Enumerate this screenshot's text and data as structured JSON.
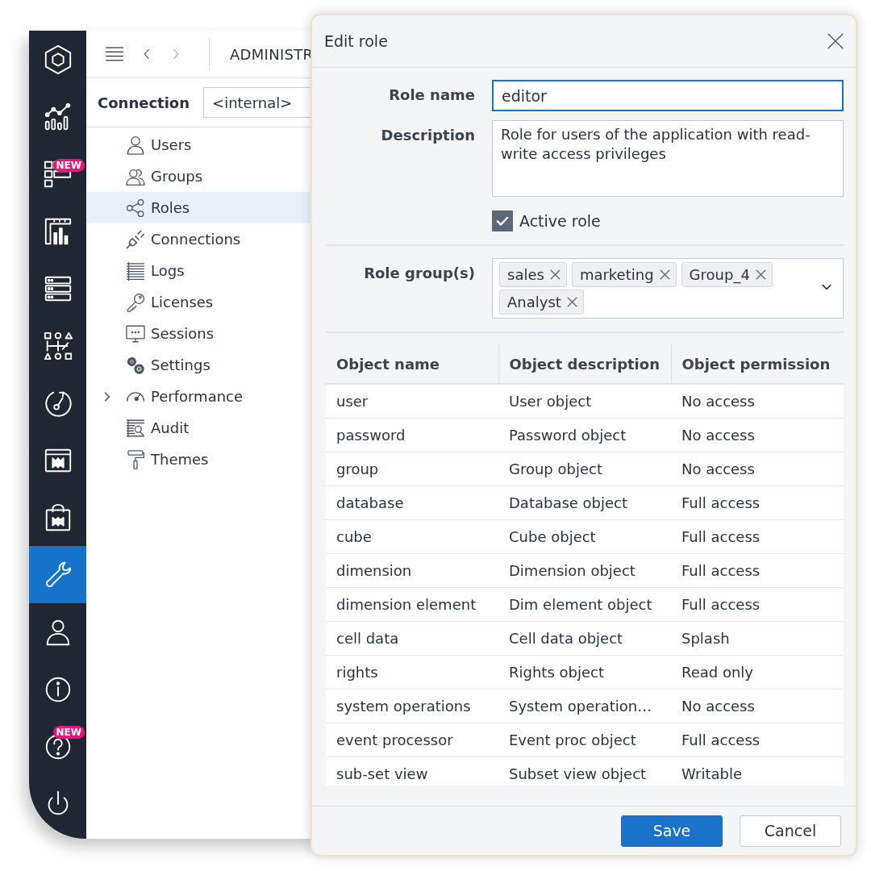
{
  "rail": {
    "items": [
      {
        "selected": false
      },
      {
        "selected": false,
        "badge": "NEW"
      },
      {
        "selected": false
      },
      {
        "selected": false
      },
      {
        "selected": false
      },
      {
        "selected": false
      },
      {
        "selected": false
      },
      {
        "selected": false
      },
      {
        "selected": true
      },
      {
        "selected": false
      },
      {
        "selected": false
      },
      {
        "selected": false,
        "badge": "NEW"
      },
      {
        "selected": false
      }
    ]
  },
  "toolbar": {
    "title": "ADMINISTR",
    "back_disabled": false,
    "forward_disabled": true
  },
  "connection": {
    "label": "Connection",
    "value": "<internal>"
  },
  "nav": {
    "items": [
      {
        "label": "Users",
        "selected": false
      },
      {
        "label": "Groups",
        "selected": false
      },
      {
        "label": "Roles",
        "selected": true
      },
      {
        "label": "Connections",
        "selected": false
      },
      {
        "label": "Logs",
        "selected": false
      },
      {
        "label": "Licenses",
        "selected": false
      },
      {
        "label": "Sessions",
        "selected": false
      },
      {
        "label": "Settings",
        "selected": false
      },
      {
        "label": "Performance",
        "selected": false,
        "expanded": false
      },
      {
        "label": "Audit",
        "selected": false
      },
      {
        "label": "Themes",
        "selected": false
      }
    ]
  },
  "dialog": {
    "title": "Edit role",
    "role_name": {
      "label": "Role name",
      "value": "editor",
      "focused": true
    },
    "description": {
      "label": "Description",
      "value": "Role for users of the application with read-write access privileges"
    },
    "active": {
      "label": "Active role",
      "checked": true
    },
    "role_groups": {
      "label": "Role group(s)",
      "tags": [
        "sales",
        "marketing",
        "Group_4",
        "Analyst"
      ]
    },
    "table": {
      "columns": [
        "Object name",
        "Object description",
        "Object permission"
      ],
      "rows": [
        [
          "user",
          "User object",
          "No access"
        ],
        [
          "password",
          "Password object",
          "No access"
        ],
        [
          "group",
          "Group object",
          "No access"
        ],
        [
          "database",
          "Database object",
          "Full access"
        ],
        [
          "cube",
          "Cube object",
          "Full access"
        ],
        [
          "dimension",
          "Dimension object",
          "Full access"
        ],
        [
          "dimension element",
          "Dim element object",
          "Full access"
        ],
        [
          "cell data",
          "Cell data object",
          "Splash"
        ],
        [
          "rights",
          "Rights object",
          "Read only"
        ],
        [
          "system operations",
          "System operation…",
          "No access"
        ],
        [
          "event processor",
          "Event proc object",
          "Full access"
        ],
        [
          "sub-set view",
          "Subset view object",
          "Writable"
        ]
      ]
    },
    "buttons": [
      {
        "label": "Save",
        "kind": "primary"
      },
      {
        "label": "Cancel",
        "kind": "secondary"
      }
    ]
  }
}
